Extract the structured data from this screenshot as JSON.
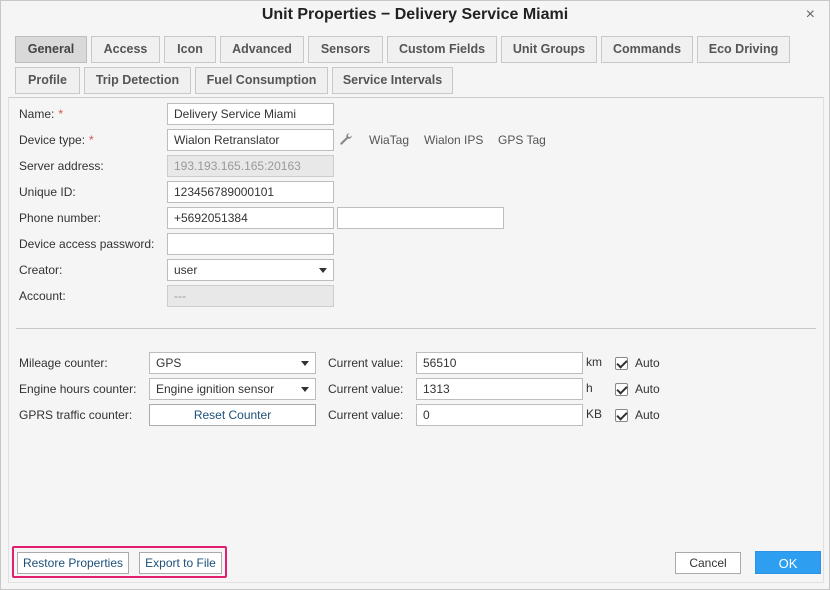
{
  "window": {
    "title": "Unit Properties − Delivery Service Miami",
    "close_label": "×"
  },
  "tabs": [
    {
      "label": "General",
      "active": true
    },
    {
      "label": "Access"
    },
    {
      "label": "Icon"
    },
    {
      "label": "Advanced"
    },
    {
      "label": "Sensors"
    },
    {
      "label": "Custom Fields"
    },
    {
      "label": "Unit Groups"
    },
    {
      "label": "Commands"
    },
    {
      "label": "Eco Driving"
    },
    {
      "label": "Profile"
    },
    {
      "label": "Trip Detection"
    },
    {
      "label": "Fuel Consumption"
    },
    {
      "label": "Service Intervals"
    }
  ],
  "general": {
    "name_label": "Name:",
    "name_value": "Delivery Service Miami",
    "device_type_label": "Device type:",
    "device_type_value": "Wialon Retranslator",
    "device_links": [
      "WiaTag",
      "Wialon IPS",
      "GPS Tag"
    ],
    "server_address_label": "Server address:",
    "server_address_value": "193.193.165.165:20163",
    "unique_id_label": "Unique ID:",
    "unique_id_value": "123456789000101",
    "phone_label": "Phone number:",
    "phone_value": "+5692051384",
    "phone2_value": "",
    "password_label": "Device access password:",
    "password_value": "",
    "creator_label": "Creator:",
    "creator_value": "user",
    "account_label": "Account:",
    "account_value": "---",
    "required_mark": "*"
  },
  "counters": {
    "current_value_label": "Current value:",
    "auto_label": "Auto",
    "mileage": {
      "label": "Mileage counter:",
      "type": "GPS",
      "value": "56510",
      "unit": "km",
      "auto": true
    },
    "engine": {
      "label": "Engine hours counter:",
      "type": "Engine ignition sensor",
      "value": "1313",
      "unit": "h",
      "auto": true
    },
    "gprs": {
      "label": "GPRS traffic counter:",
      "button": "Reset Counter",
      "value": "0",
      "unit": "KB",
      "auto": true
    }
  },
  "footer": {
    "restore_label": "Restore Properties",
    "export_label": "Export to File",
    "cancel_label": "Cancel",
    "ok_label": "OK"
  },
  "colors": {
    "accent": "#2e9ef0",
    "highlight": "#e0206e",
    "required": "#d9534f"
  }
}
